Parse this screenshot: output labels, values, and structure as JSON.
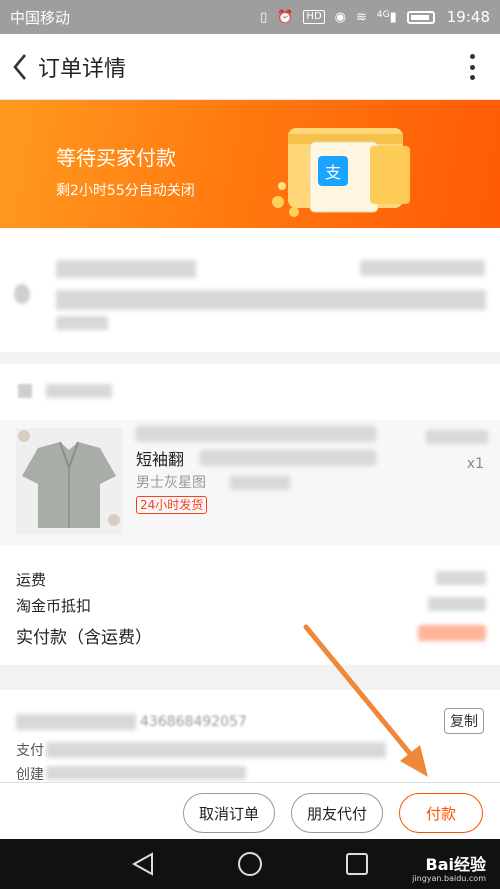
{
  "status_bar": {
    "carrier": "中国移动",
    "network": "4G",
    "hd_badge": "HD",
    "time": "19:48"
  },
  "nav": {
    "title": "订单详情"
  },
  "banner": {
    "title": "等待买家付款",
    "countdown": "剩2小时55分自动关闭",
    "accent_color": "#ff6a00"
  },
  "product": {
    "name_fragment": "短袖翻",
    "spec_fragment": "男士灰星图",
    "shipping_badge": "24小时发货",
    "quantity": "x1"
  },
  "fees": {
    "shipping_label": "运费",
    "coin_discount_label": "淘金币抵扣",
    "total_label": "实付款（含运费）"
  },
  "order_info": {
    "number_fragment": "436868492057",
    "copy_label": "复制",
    "alipay_label_fragment": "支付",
    "created_label_fragment": "创建"
  },
  "actions": {
    "cancel_label": "取消订单",
    "friend_pay_label": "朋友代付",
    "pay_label": "付款",
    "pay_color": "#ff5000"
  },
  "watermark": {
    "brand": "Bai经验",
    "site": "jingyan.baidu.com"
  }
}
